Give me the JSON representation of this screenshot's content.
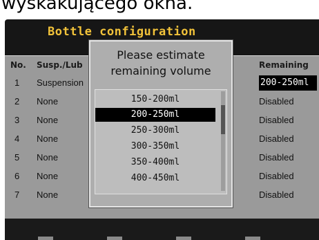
{
  "caption": "wyskakującego okna.",
  "screen": {
    "title": "Bottle configuration",
    "columns": {
      "no": "No.",
      "susp": "Susp./Lub",
      "remaining": "Remaining"
    },
    "rows": [
      {
        "no": "1",
        "susp": "Suspension",
        "remaining": "200-250ml"
      },
      {
        "no": "2",
        "susp": "None",
        "remaining": "Disabled"
      },
      {
        "no": "3",
        "susp": "None",
        "remaining": "Disabled"
      },
      {
        "no": "4",
        "susp": "None",
        "remaining": "Disabled"
      },
      {
        "no": "5",
        "susp": "None",
        "remaining": "Disabled"
      },
      {
        "no": "6",
        "susp": "None",
        "remaining": "Disabled"
      },
      {
        "no": "7",
        "susp": "None",
        "remaining": "Disabled"
      }
    ]
  },
  "dialog": {
    "title_line1": "Please estimate",
    "title_line2": "remaining volume",
    "options": [
      "150-200ml",
      "200-250ml",
      "250-300ml",
      "300-350ml",
      "350-400ml",
      "400-450ml"
    ],
    "selected_index": 1
  },
  "colors": {
    "title": "#f1c23a",
    "selection": "#000000"
  }
}
